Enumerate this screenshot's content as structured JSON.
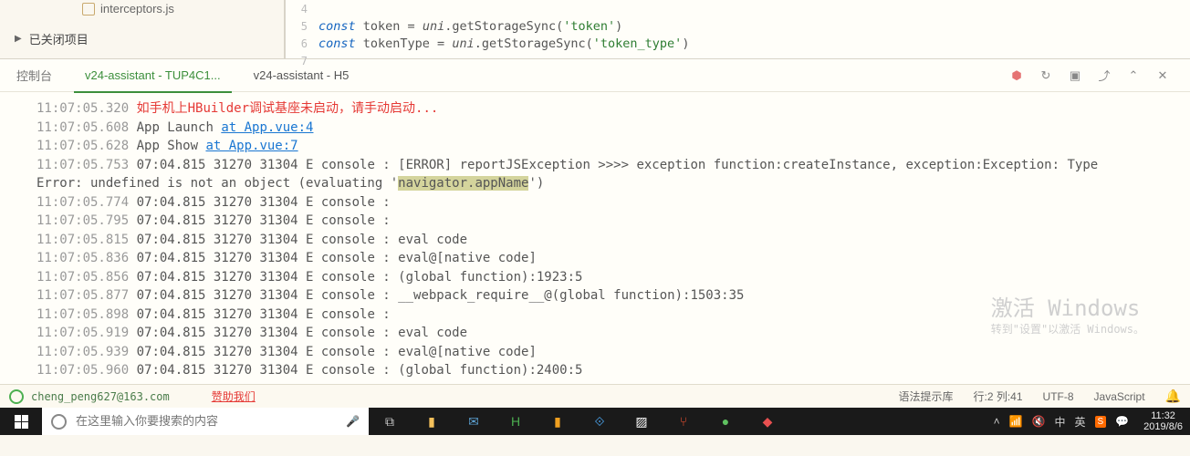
{
  "sidebar": {
    "file": "interceptors.js",
    "closed_projects": "已关闭项目"
  },
  "editor": {
    "lines": [
      {
        "n": "4",
        "html": ""
      },
      {
        "n": "5",
        "html": "<span class='kw'>const</span> <span class='pln'>token = </span><span class='obj'>uni</span><span class='pln'>.getStorageSync(</span><span class='str'>'token'</span><span class='pln'>)</span>"
      },
      {
        "n": "6",
        "html": "<span class='kw'>const</span> <span class='pln'>tokenType = </span><span class='obj'>uni</span><span class='pln'>.getStorageSync(</span><span class='str'>'token_type'</span><span class='pln'>)</span>"
      },
      {
        "n": "7",
        "html": ""
      }
    ]
  },
  "console": {
    "tab_left": "控制台",
    "tab_active": "v24-assistant - TUP4C1...",
    "tab_other": "v24-assistant - H5",
    "logs": [
      {
        "ts": "11:07:05.320",
        "parts": [
          {
            "t": " ",
            "c": ""
          },
          {
            "t": "如手机上HBuilder调试基座未启动，请手动启动...",
            "c": "red"
          }
        ]
      },
      {
        "ts": "11:07:05.608",
        "parts": [
          {
            "t": " App Launch ",
            "c": ""
          },
          {
            "t": "at App.vue:4",
            "c": "link"
          }
        ]
      },
      {
        "ts": "11:07:05.628",
        "parts": [
          {
            "t": " App Show ",
            "c": ""
          },
          {
            "t": "at App.vue:7",
            "c": "link"
          }
        ]
      },
      {
        "ts": "11:07:05.753",
        "parts": [
          {
            "t": " 07:04.815 31270 31304 E console : [ERROR] reportJSException >>>> exception function:createInstance, exception:Exception: Type",
            "c": ""
          }
        ]
      },
      {
        "ts": "",
        "parts": [
          {
            "t": "Error: undefined is not an object (evaluating '",
            "c": ""
          },
          {
            "t": "navigator.appName",
            "c": "hl"
          },
          {
            "t": "')",
            "c": ""
          }
        ]
      },
      {
        "ts": "11:07:05.774",
        "parts": [
          {
            "t": " 07:04.815 31270 31304 E console :",
            "c": ""
          }
        ]
      },
      {
        "ts": "11:07:05.795",
        "parts": [
          {
            "t": " 07:04.815 31270 31304 E console :",
            "c": ""
          }
        ]
      },
      {
        "ts": "11:07:05.815",
        "parts": [
          {
            "t": " 07:04.815 31270 31304 E console : eval code",
            "c": ""
          }
        ]
      },
      {
        "ts": "11:07:05.836",
        "parts": [
          {
            "t": " 07:04.815 31270 31304 E console : eval@[native code]",
            "c": ""
          }
        ]
      },
      {
        "ts": "11:07:05.856",
        "parts": [
          {
            "t": " 07:04.815 31270 31304 E console : (global function):1923:5",
            "c": ""
          }
        ]
      },
      {
        "ts": "11:07:05.877",
        "parts": [
          {
            "t": " 07:04.815 31270 31304 E console : __webpack_require__@(global function):1503:35",
            "c": ""
          }
        ]
      },
      {
        "ts": "11:07:05.898",
        "parts": [
          {
            "t": " 07:04.815 31270 31304 E console :",
            "c": ""
          }
        ]
      },
      {
        "ts": "11:07:05.919",
        "parts": [
          {
            "t": " 07:04.815 31270 31304 E console : eval code",
            "c": ""
          }
        ]
      },
      {
        "ts": "11:07:05.939",
        "parts": [
          {
            "t": " 07:04.815 31270 31304 E console : eval@[native code]",
            "c": ""
          }
        ]
      },
      {
        "ts": "11:07:05.960",
        "parts": [
          {
            "t": " 07:04.815 31270 31304 E console : (global function):2400:5",
            "c": ""
          }
        ]
      }
    ]
  },
  "watermark": {
    "title": "激活 Windows",
    "sub": "转到\"设置\"以激活 Windows。"
  },
  "statusbar": {
    "email": "cheng_peng627@163.com",
    "sponsor": "赞助我们",
    "syntax": "语法提示库",
    "pos": "行:2  列:41",
    "encoding": "UTF-8",
    "lang": "JavaScript"
  },
  "taskbar": {
    "search_placeholder": "在这里输入你要搜索的内容",
    "ime1": "中",
    "ime2": "英",
    "time": "11:32",
    "date": "2019/8/6"
  }
}
